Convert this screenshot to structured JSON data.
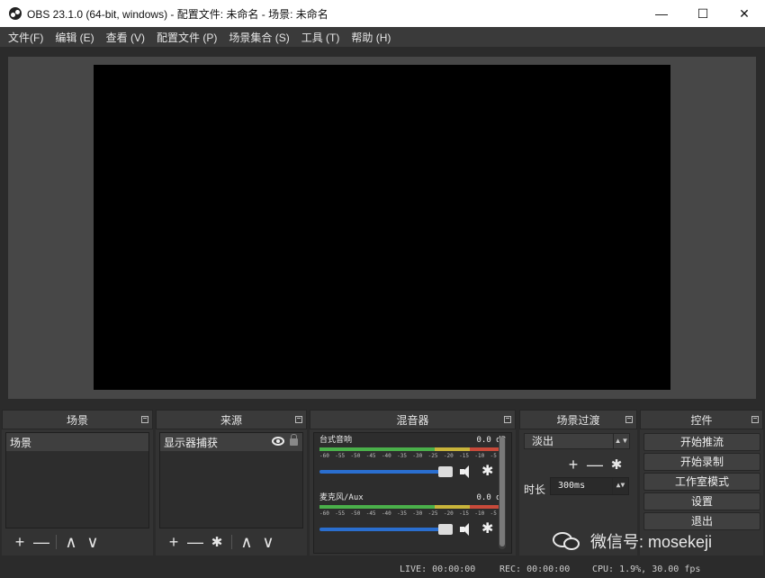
{
  "window": {
    "title": "OBS 23.1.0 (64-bit, windows) - 配置文件: 未命名 - 场景: 未命名",
    "min_glyph": "—",
    "max_glyph": "☐",
    "close_glyph": "✕"
  },
  "menu": [
    "文件(F)",
    "编辑 (E)",
    "查看 (V)",
    "配置文件 (P)",
    "场景集合 (S)",
    "工具 (T)",
    "帮助 (H)"
  ],
  "docks": {
    "scenes": {
      "title": "场景",
      "items": [
        "场景"
      ]
    },
    "sources": {
      "title": "来源",
      "items": [
        "显示器捕获"
      ]
    },
    "mixer": {
      "title": "混音器",
      "channels": [
        {
          "name": "台式音响",
          "db": "0.0 dB",
          "volume": 1.0
        },
        {
          "name": "麦克风/Aux",
          "db": "0.0 dB",
          "volume": 1.0
        }
      ],
      "ticks": [
        "-60",
        "-55",
        "-50",
        "-45",
        "-40",
        "-35",
        "-30",
        "-25",
        "-20",
        "-15",
        "-10",
        "-5",
        "0"
      ]
    },
    "transitions": {
      "title": "场景过渡",
      "selected": "淡出",
      "duration_label": "时长",
      "duration_value": "300ms"
    },
    "controls": {
      "title": "控件",
      "buttons": [
        "开始推流",
        "开始录制",
        "工作室模式",
        "设置",
        "退出"
      ]
    }
  },
  "toolbar_glyphs": {
    "add": "+",
    "remove": "—",
    "up": "∧",
    "down": "∨",
    "gear": "✱"
  },
  "status": {
    "live": "LIVE: 00:00:00",
    "rec": "REC: 00:00:00",
    "cpu": "CPU: 1.9%, 30.00 fps"
  },
  "watermark": "微信号: mosekeji",
  "colors": {
    "accent": "#2a6ecf",
    "meter_green": "#4ab04a",
    "meter_yellow": "#c8b43a",
    "meter_red": "#c84a3a"
  }
}
